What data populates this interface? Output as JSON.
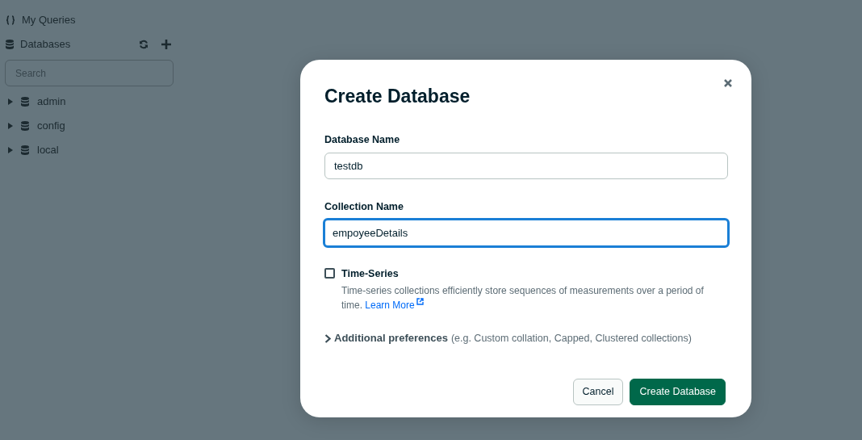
{
  "sidebar": {
    "items": [
      {
        "label": "My Queries",
        "kind": "queries"
      },
      {
        "label": "Databases",
        "kind": "databases"
      }
    ],
    "search": {
      "placeholder": "Search"
    },
    "databases": [
      {
        "name": "admin",
        "expanded": false
      },
      {
        "name": "config",
        "expanded": false
      },
      {
        "name": "local",
        "expanded": false
      }
    ]
  },
  "modal": {
    "title": "Create Database",
    "fields": [
      {
        "label": "Database Name",
        "value": "testdb",
        "focused": false
      },
      {
        "label": "Collection Name",
        "value": "empoyeeDetails",
        "focused": true
      }
    ],
    "option": {
      "label": "Time-Series",
      "checked": false,
      "description": "Time-series collections efficiently store sequences of measurements over a period of time.",
      "link": "Learn More"
    },
    "more": {
      "label": "Additional preferences",
      "hint": "(e.g. Custom collation, Capped, Clustered collections)",
      "expanded": false
    },
    "buttons": [
      {
        "label": "Cancel",
        "kind": "secondary"
      },
      {
        "label": "Create Database",
        "kind": "primary"
      }
    ]
  }
}
